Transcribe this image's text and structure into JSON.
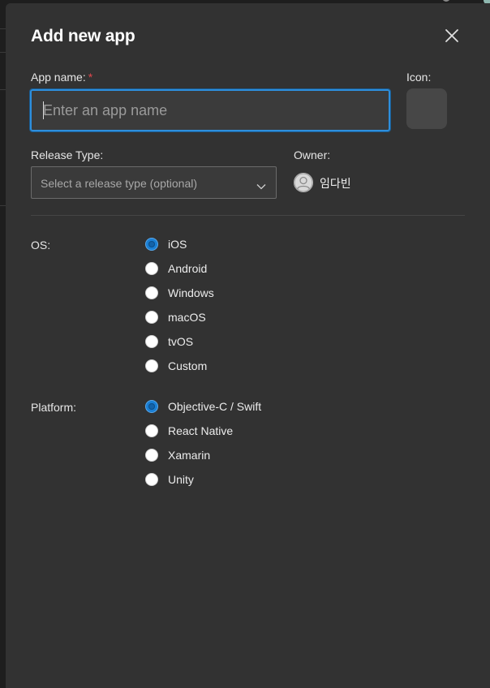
{
  "dialog": {
    "title": "Add new app",
    "close_icon": "close-icon"
  },
  "app_name": {
    "label": "App name:",
    "required_mark": "*",
    "placeholder": "Enter an app name",
    "value": ""
  },
  "icon": {
    "label": "Icon:"
  },
  "release_type": {
    "label": "Release Type:",
    "placeholder": "Select a release type (optional)",
    "chevron_icon": "chevron-down-icon"
  },
  "owner": {
    "label": "Owner:",
    "name": "임다빈",
    "avatar_icon": "user-avatar-icon"
  },
  "os": {
    "label": "OS:",
    "options": [
      "iOS",
      "Android",
      "Windows",
      "macOS",
      "tvOS",
      "Custom"
    ],
    "selected": "iOS"
  },
  "platform": {
    "label": "Platform:",
    "options": [
      "Objective-C / Swift",
      "React Native",
      "Xamarin",
      "Unity"
    ],
    "selected": "Objective-C / Swift"
  },
  "colors": {
    "accent": "#1a7fd4",
    "focus_border": "#2d8fdd",
    "required": "#e0474c",
    "panel_bg": "#323232"
  }
}
